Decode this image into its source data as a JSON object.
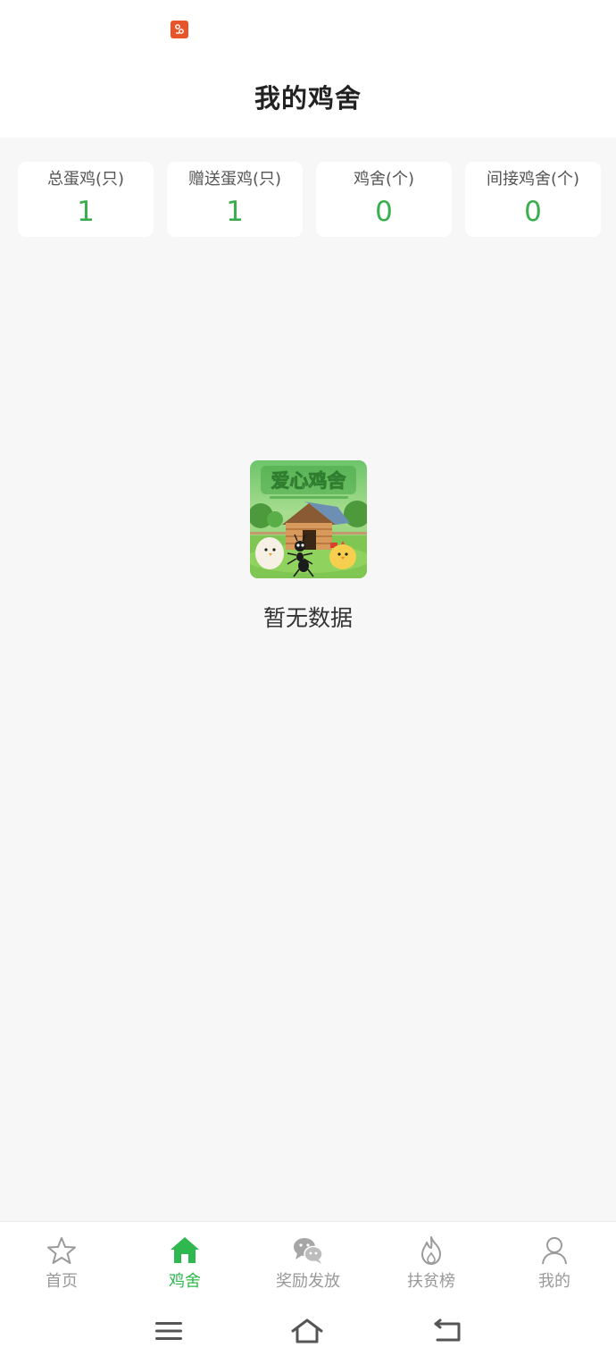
{
  "header": {
    "title": "我的鸡舍"
  },
  "stats": [
    {
      "label": "总蛋鸡(只)",
      "value": "1"
    },
    {
      "label": "赠送蛋鸡(只)",
      "value": "1"
    },
    {
      "label": "鸡舍(个)",
      "value": "0"
    },
    {
      "label": "间接鸡舍(个)",
      "value": "0"
    }
  ],
  "empty_state": {
    "banner_text": "爱心鸡舍",
    "message": "暂无数据"
  },
  "tabbar": {
    "items": [
      {
        "label": "首页",
        "icon": "star-icon",
        "active": false
      },
      {
        "label": "鸡舍",
        "icon": "house-icon",
        "active": true
      },
      {
        "label": "奖励发放",
        "icon": "wechat-icon",
        "active": false
      },
      {
        "label": "扶贫榜",
        "icon": "flame-icon",
        "active": false
      },
      {
        "label": "我的",
        "icon": "user-icon",
        "active": false
      }
    ]
  },
  "colors": {
    "accent_green": "#2fb84f",
    "stat_value_green": "#3aae4f",
    "inactive_gray": "#999999",
    "notification_orange": "#e8542a"
  },
  "system_nav": {
    "icons": [
      "menu-icon",
      "home-icon",
      "back-icon"
    ]
  }
}
